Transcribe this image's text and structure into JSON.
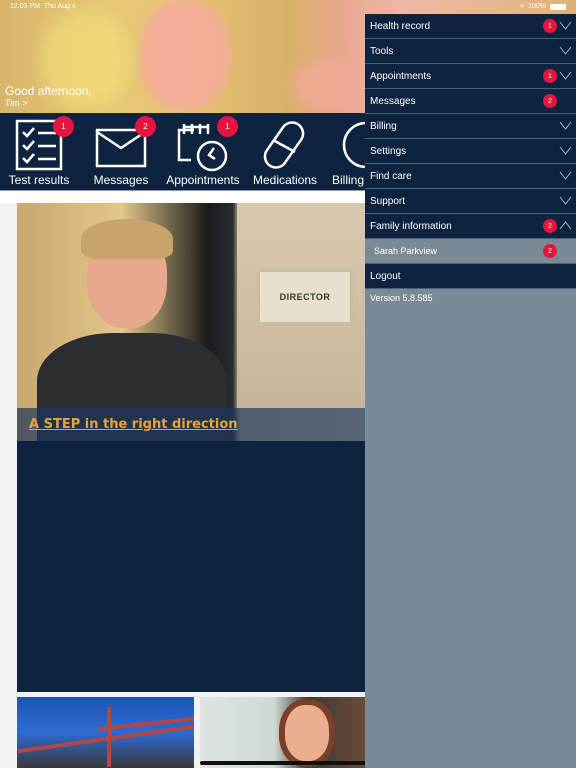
{
  "status_bar": {
    "time": "12:03 PM",
    "date": "Thu Aug 4",
    "battery": "100%"
  },
  "header": {
    "greeting": "Good afternoon,",
    "user_link": "Tim >"
  },
  "quick_actions": [
    {
      "label": "Test results",
      "icon": "checklist-icon",
      "badge": "1"
    },
    {
      "label": "Messages",
      "icon": "envelope-icon",
      "badge": "2"
    },
    {
      "label": "Appointments",
      "icon": "calendar-clock-icon",
      "badge": "1"
    },
    {
      "label": "Medications",
      "icon": "pill-icon",
      "badge": null
    },
    {
      "label": "Billing",
      "icon": "billing-icon",
      "badge": null
    }
  ],
  "feed": {
    "featured": {
      "headline": "A STEP in the right direction",
      "sign_text": "DIRECTOR"
    }
  },
  "menu": {
    "items": [
      {
        "label": "Health record",
        "badge": "1",
        "chevron": "down"
      },
      {
        "label": "Tools",
        "badge": null,
        "chevron": "down"
      },
      {
        "label": "Appointments",
        "badge": "1",
        "chevron": "down"
      },
      {
        "label": "Messages",
        "badge": "2",
        "chevron": null
      },
      {
        "label": "Billing",
        "badge": null,
        "chevron": "down"
      },
      {
        "label": "Settings",
        "badge": null,
        "chevron": "down"
      },
      {
        "label": "Find care",
        "badge": null,
        "chevron": "down"
      },
      {
        "label": "Support",
        "badge": null,
        "chevron": "down"
      },
      {
        "label": "Family information",
        "badge": "2",
        "chevron": "up"
      }
    ],
    "family_sub": {
      "label": "Sarah Parkview",
      "badge": "2"
    },
    "logout": "Logout",
    "version": "Version 5.8.585"
  },
  "colors": {
    "navy": "#0e2340",
    "badge_red": "#e3173e",
    "drawer_gray": "#798a96",
    "headline_orange": "#e8a23b"
  }
}
